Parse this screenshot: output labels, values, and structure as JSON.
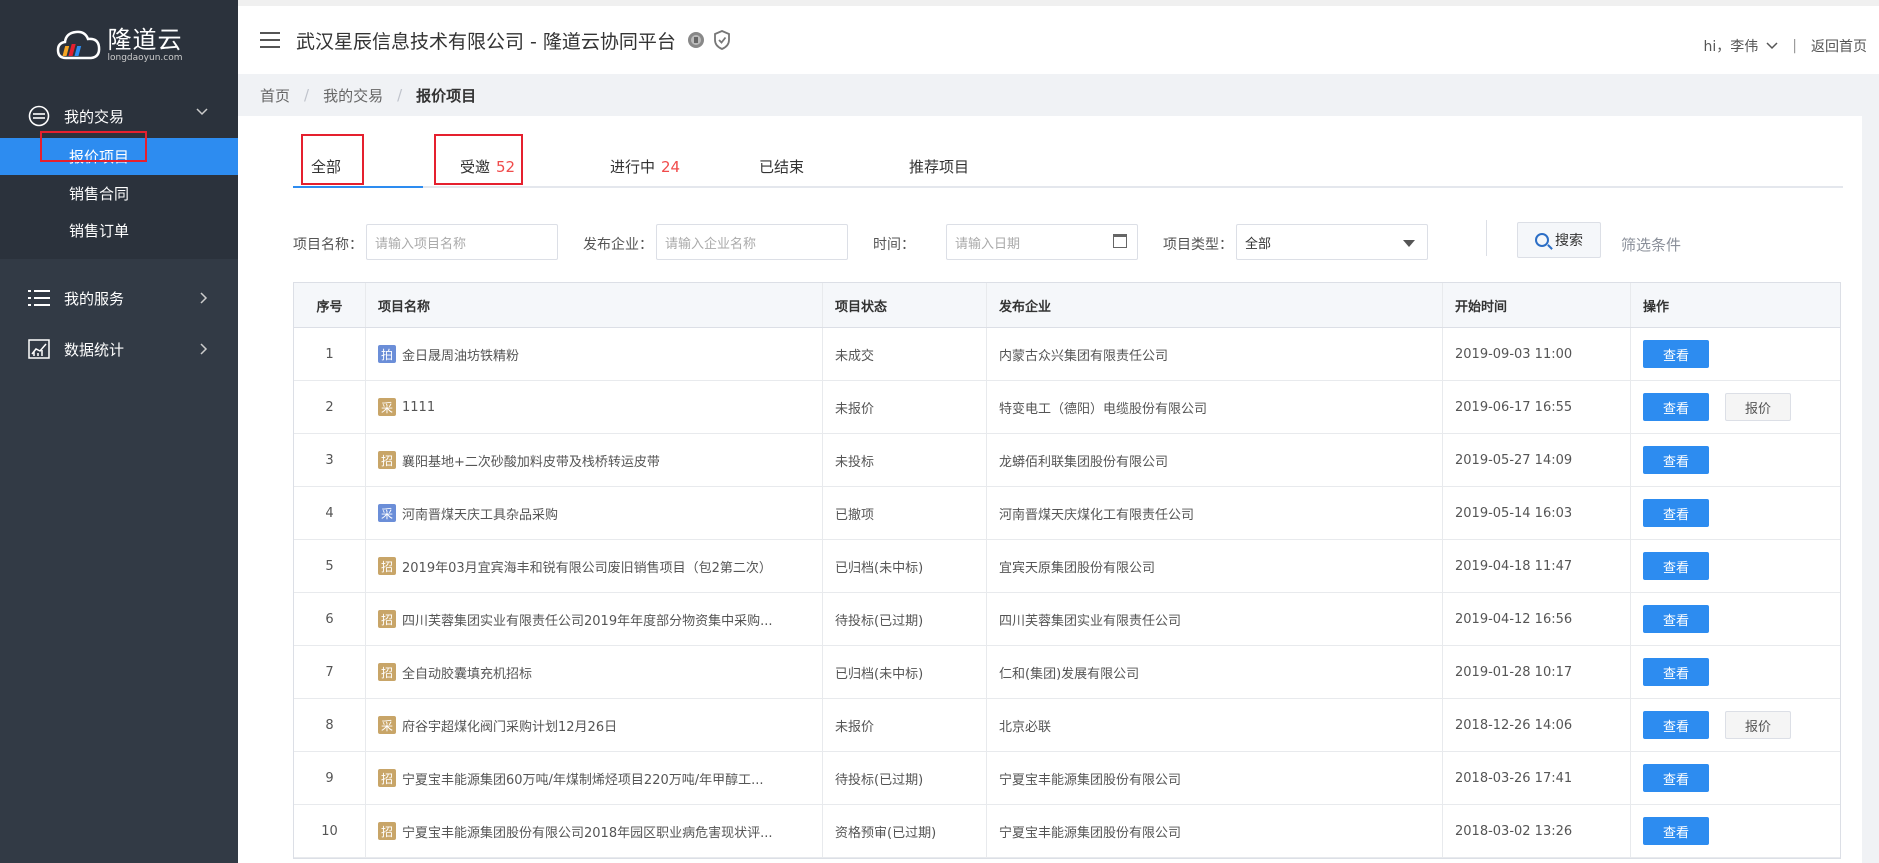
{
  "logo": {
    "name": "隆道云",
    "sub": "longdaoyun.com"
  },
  "sidebar": {
    "groups": [
      {
        "label": "我的交易",
        "items": [
          "报价项目",
          "销售合同",
          "销售订单"
        ]
      },
      {
        "label": "我的服务"
      },
      {
        "label": "数据统计"
      }
    ]
  },
  "topbar": {
    "title": "武汉星辰信息技术有限公司 - 隆道云协同平台",
    "user": "hi，李伟",
    "back": "返回首页"
  },
  "breadcrumb": [
    "首页",
    "我的交易",
    "报价项目"
  ],
  "tabs": [
    {
      "label": "全部",
      "count": ""
    },
    {
      "label": "受邀",
      "count": "52"
    },
    {
      "label": "进行中",
      "count": "24"
    },
    {
      "label": "已结束",
      "count": ""
    },
    {
      "label": "推荐项目",
      "count": ""
    }
  ],
  "filters": {
    "name_label": "项目名称：",
    "name_placeholder": "请输入项目名称",
    "corp_label": "发布企业：",
    "corp_placeholder": "请输入企业名称",
    "time_label": "时间：",
    "time_placeholder": "请输入日期",
    "type_label": "项目类型：",
    "type_value": "全部",
    "search": "搜索",
    "more": "筛选条件"
  },
  "table": {
    "headers": [
      "序号",
      "项目名称",
      "项目状态",
      "发布企业",
      "开始时间",
      "操作"
    ],
    "view_label": "查看",
    "quote_label": "报价",
    "rows": [
      {
        "no": "1",
        "tag": "拍",
        "name": "金日晟周油坊铁精粉",
        "status": "未成交",
        "corp": "内蒙古众兴集团有限责任公司",
        "time": "2019-09-03 11:00",
        "quote": false
      },
      {
        "no": "2",
        "tag": "采",
        "name": "1111",
        "status": "未报价",
        "corp": "特变电工（德阳）电缆股份有限公司",
        "time": "2019-06-17 16:55",
        "quote": true
      },
      {
        "no": "3",
        "tag": "招",
        "name": "襄阳基地+二次砂酸加料皮带及栈桥转运皮带",
        "status": "未投标",
        "corp": "龙蟒佰利联集团股份有限公司",
        "time": "2019-05-27 14:09",
        "quote": false
      },
      {
        "no": "4",
        "tag": "采",
        "name": "河南晋煤天庆工具杂品采购",
        "status": "已撤项",
        "corp": "河南晋煤天庆煤化工有限责任公司",
        "time": "2019-05-14 16:03",
        "quote": false
      },
      {
        "no": "5",
        "tag": "招",
        "name": "2019年03月宜宾海丰和锐有限公司废旧销售项目（包2第二次）",
        "status": "已归档(未中标)",
        "corp": "宜宾天原集团股份有限公司",
        "time": "2019-04-18 11:47",
        "quote": false
      },
      {
        "no": "6",
        "tag": "招",
        "name": "四川芙蓉集团实业有限责任公司2019年年度部分物资集中采购...",
        "status": "待投标(已过期)",
        "corp": "四川芙蓉集团实业有限责任公司",
        "time": "2019-04-12 16:56",
        "quote": false
      },
      {
        "no": "7",
        "tag": "招",
        "name": "全自动胶囊填充机招标",
        "status": "已归档(未中标)",
        "corp": "仁和(集团)发展有限公司",
        "time": "2019-01-28 10:17",
        "quote": false
      },
      {
        "no": "8",
        "tag": "采",
        "name": "府谷宇超煤化阀门采购计划12月26日",
        "status": "未报价",
        "corp": "北京必联",
        "time": "2018-12-26 14:06",
        "quote": true
      },
      {
        "no": "9",
        "tag": "招",
        "name": "宁夏宝丰能源集团60万吨/年煤制烯烃项目220万吨/年甲醇工...",
        "status": "待投标(已过期)",
        "corp": "宁夏宝丰能源集团股份有限公司",
        "time": "2018-03-26 17:41",
        "quote": false
      },
      {
        "no": "10",
        "tag": "招",
        "name": "宁夏宝丰能源集团股份有限公司2018年园区职业病危害现状评...",
        "status": "资格预审(已过期)",
        "corp": "宁夏宝丰能源集团股份有限公司",
        "time": "2018-03-02 13:26",
        "quote": false
      }
    ]
  },
  "colors": {
    "sidebar": "#323a45",
    "accent": "#2d8cf0",
    "highlight": "#e5202e",
    "count": "#f04b4b"
  }
}
